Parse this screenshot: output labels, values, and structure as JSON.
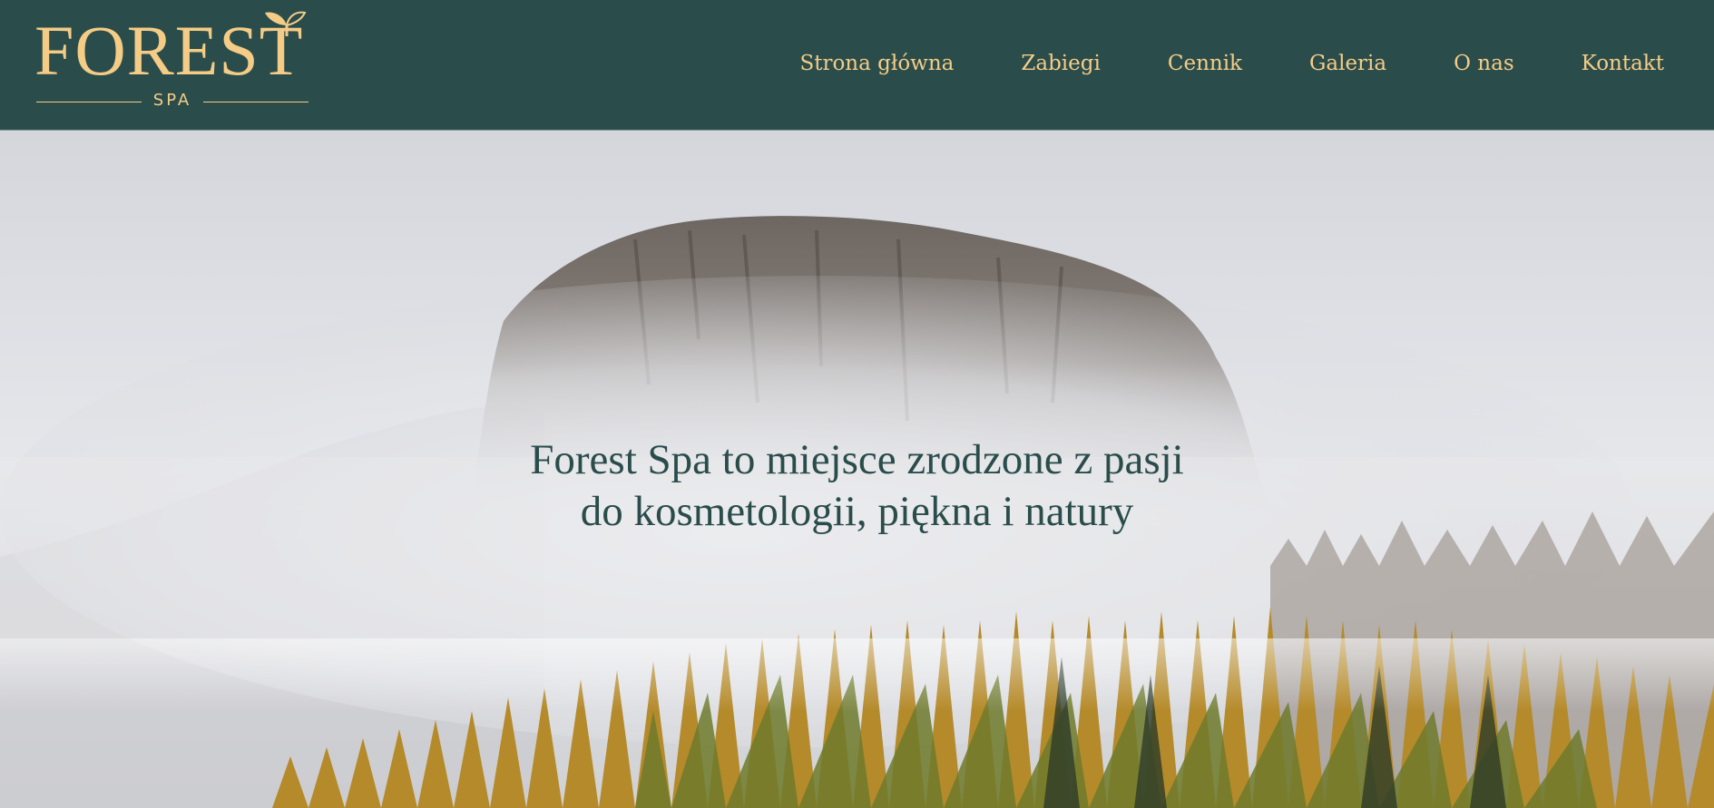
{
  "logo": {
    "word": "FOREST",
    "sub": "SPA"
  },
  "nav": {
    "items": [
      {
        "label": "Strona główna"
      },
      {
        "label": "Zabiegi"
      },
      {
        "label": "Cennik"
      },
      {
        "label": "Galeria"
      },
      {
        "label": "O nas"
      },
      {
        "label": "Kontakt"
      }
    ]
  },
  "hero": {
    "line1": "Forest Spa to miejsce zrodzone z pasji",
    "line2": "do kosmetologii, piękna i natury"
  },
  "colors": {
    "header_bg": "#2a4d4c",
    "accent": "#f5cc86",
    "hero_text": "#2a4d4c"
  }
}
